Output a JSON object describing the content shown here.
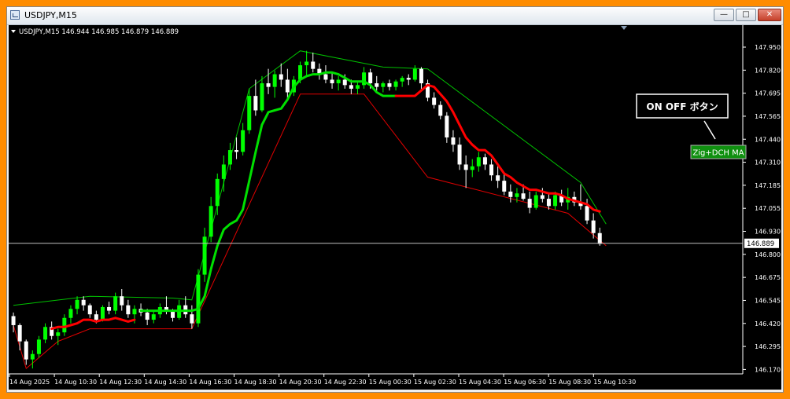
{
  "window": {
    "title": "USDJPY,M15",
    "minimize_label": "—",
    "maximize_label": "□",
    "close_label": "✕"
  },
  "chart_data": {
    "type": "candlestick",
    "symbol_header": "USDJPY,M15  146.944 146.985 146.879 146.889",
    "current_price_label": "146.889",
    "ylim": [
      146.17,
      148.05
    ],
    "yticks": [
      "147.950",
      "147.820",
      "147.695",
      "147.565",
      "147.440",
      "147.310",
      "147.185",
      "147.055",
      "146.930",
      "146.800",
      "146.675",
      "146.545",
      "146.420",
      "146.295",
      "146.170"
    ],
    "xticks": [
      "14 Aug 2025",
      "14 Aug 10:30",
      "14 Aug 12:30",
      "14 Aug 14:30",
      "14 Aug 16:30",
      "14 Aug 18:30",
      "14 Aug 20:30",
      "14 Aug 22:30",
      "15 Aug 00:30",
      "15 Aug 02:30",
      "15 Aug 04:30",
      "15 Aug 06:30",
      "15 Aug 08:30",
      "15 Aug 10:30"
    ],
    "grid": false,
    "colors": {
      "background": "#000000",
      "candle_up": "#00ff00",
      "candle_down": "#ffffff",
      "ma_up": "#00e000",
      "ma_down": "#ff0000",
      "channel_upper": "#00c000",
      "channel_lower": "#e00000",
      "axis_text": "#ffffff",
      "price_line": "#c0c0c0"
    },
    "candles": [
      [
        146.49,
        146.51,
        146.4,
        146.44
      ],
      [
        146.44,
        146.45,
        146.3,
        146.35
      ],
      [
        146.35,
        146.36,
        146.22,
        146.25
      ],
      [
        146.25,
        146.3,
        146.2,
        146.28
      ],
      [
        146.28,
        146.38,
        146.26,
        146.36
      ],
      [
        146.36,
        146.45,
        146.34,
        146.43
      ],
      [
        146.43,
        146.46,
        146.36,
        146.38
      ],
      [
        146.38,
        146.42,
        146.33,
        146.4
      ],
      [
        146.4,
        146.5,
        146.38,
        146.48
      ],
      [
        146.48,
        146.55,
        146.45,
        146.53
      ],
      [
        146.53,
        146.6,
        146.5,
        146.58
      ],
      [
        146.58,
        146.6,
        146.52,
        146.55
      ],
      [
        146.55,
        146.56,
        146.48,
        146.5
      ],
      [
        146.5,
        146.52,
        146.45,
        146.47
      ],
      [
        146.47,
        146.55,
        146.46,
        146.54
      ],
      [
        146.54,
        146.57,
        146.5,
        146.52
      ],
      [
        146.52,
        146.62,
        146.5,
        146.6
      ],
      [
        146.6,
        146.64,
        146.52,
        146.55
      ],
      [
        146.55,
        146.58,
        146.48,
        146.5
      ],
      [
        146.5,
        146.55,
        146.45,
        146.53
      ],
      [
        146.53,
        146.56,
        146.49,
        146.51
      ],
      [
        146.51,
        146.53,
        146.44,
        146.47
      ],
      [
        146.47,
        146.52,
        146.45,
        146.5
      ],
      [
        146.5,
        146.56,
        146.48,
        146.54
      ],
      [
        146.54,
        146.6,
        146.5,
        146.52
      ],
      [
        146.52,
        146.53,
        146.46,
        146.48
      ],
      [
        146.48,
        146.58,
        146.47,
        146.55
      ],
      [
        146.55,
        146.6,
        146.48,
        146.5
      ],
      [
        146.5,
        146.55,
        146.42,
        146.45
      ],
      [
        146.45,
        146.75,
        146.43,
        146.72
      ],
      [
        146.72,
        146.98,
        146.68,
        146.93
      ],
      [
        146.93,
        147.15,
        146.9,
        147.1
      ],
      [
        147.1,
        147.28,
        147.05,
        147.25
      ],
      [
        147.25,
        147.38,
        147.18,
        147.33
      ],
      [
        147.33,
        147.45,
        147.3,
        147.41
      ],
      [
        147.41,
        147.48,
        147.36,
        147.4
      ],
      [
        147.4,
        147.56,
        147.38,
        147.52
      ],
      [
        147.52,
        147.75,
        147.5,
        147.71
      ],
      [
        147.71,
        147.8,
        147.6,
        147.63
      ],
      [
        147.63,
        147.82,
        147.62,
        147.78
      ],
      [
        147.78,
        147.86,
        147.72,
        147.76
      ],
      [
        147.76,
        147.85,
        147.7,
        147.83
      ],
      [
        147.83,
        147.89,
        147.76,
        147.8
      ],
      [
        147.8,
        147.86,
        147.7,
        147.73
      ],
      [
        147.73,
        147.82,
        147.71,
        147.8
      ],
      [
        147.8,
        147.9,
        147.78,
        147.88
      ],
      [
        147.88,
        147.96,
        147.82,
        147.9
      ],
      [
        147.9,
        147.95,
        147.84,
        147.86
      ],
      [
        147.86,
        147.89,
        147.8,
        147.83
      ],
      [
        147.83,
        147.88,
        147.78,
        147.8
      ],
      [
        147.8,
        147.84,
        147.75,
        147.78
      ],
      [
        147.78,
        147.82,
        147.74,
        147.8
      ],
      [
        147.8,
        147.83,
        147.75,
        147.77
      ],
      [
        147.77,
        147.8,
        147.72,
        147.75
      ],
      [
        147.75,
        147.79,
        147.72,
        147.77
      ],
      [
        147.77,
        147.87,
        147.75,
        147.84
      ],
      [
        147.84,
        147.86,
        147.75,
        147.78
      ],
      [
        147.78,
        147.82,
        147.74,
        147.76
      ],
      [
        147.76,
        147.79,
        147.73,
        147.78
      ],
      [
        147.78,
        147.8,
        147.74,
        147.76
      ],
      [
        147.76,
        147.8,
        147.74,
        147.79
      ],
      [
        147.79,
        147.82,
        147.76,
        147.81
      ],
      [
        147.81,
        147.83,
        147.77,
        147.8
      ],
      [
        147.8,
        147.88,
        147.79,
        147.86
      ],
      [
        147.86,
        147.87,
        147.75,
        147.78
      ],
      [
        147.78,
        147.8,
        147.68,
        147.7
      ],
      [
        147.7,
        147.73,
        147.64,
        147.66
      ],
      [
        147.66,
        147.68,
        147.58,
        147.6
      ],
      [
        147.6,
        147.62,
        147.45,
        147.48
      ],
      [
        147.48,
        147.52,
        147.4,
        147.44
      ],
      [
        147.44,
        147.48,
        147.3,
        147.33
      ],
      [
        147.33,
        147.38,
        147.2,
        147.3
      ],
      [
        147.3,
        147.36,
        147.26,
        147.32
      ],
      [
        147.32,
        147.4,
        147.29,
        147.37
      ],
      [
        147.37,
        147.39,
        147.3,
        147.33
      ],
      [
        147.33,
        147.36,
        147.24,
        147.27
      ],
      [
        147.27,
        147.32,
        147.2,
        147.24
      ],
      [
        147.24,
        147.28,
        147.16,
        147.18
      ],
      [
        147.18,
        147.22,
        147.12,
        147.15
      ],
      [
        147.15,
        147.2,
        147.12,
        147.17
      ],
      [
        147.17,
        147.22,
        147.13,
        147.14
      ],
      [
        147.14,
        147.18,
        147.06,
        147.09
      ],
      [
        147.09,
        147.18,
        147.08,
        147.16
      ],
      [
        147.16,
        147.2,
        147.12,
        147.14
      ],
      [
        147.14,
        147.17,
        147.08,
        147.1
      ],
      [
        147.1,
        147.18,
        147.08,
        147.16
      ],
      [
        147.16,
        147.19,
        147.1,
        147.12
      ],
      [
        147.12,
        147.2,
        147.08,
        147.15
      ],
      [
        147.15,
        147.18,
        147.1,
        147.12
      ],
      [
        147.12,
        147.22,
        147.08,
        147.1
      ],
      [
        147.1,
        147.14,
        147.0,
        147.02
      ],
      [
        147.02,
        147.06,
        146.92,
        146.95
      ],
      [
        146.95,
        146.98,
        146.88,
        146.89
      ]
    ],
    "ma_series": [
      {
        "color": "red",
        "points": [
          [
            6,
            146.42
          ],
          [
            7,
            146.43
          ],
          [
            8,
            146.43
          ],
          [
            9,
            146.44
          ],
          [
            10,
            146.45
          ],
          [
            11,
            146.47
          ],
          [
            12,
            146.47
          ],
          [
            13,
            146.46
          ],
          [
            14,
            146.47
          ],
          [
            15,
            146.47
          ],
          [
            16,
            146.48
          ],
          [
            17,
            146.47
          ],
          [
            18,
            146.46
          ],
          [
            19,
            146.47
          ]
        ]
      },
      {
        "color": "green",
        "points": [
          [
            20,
            146.52
          ],
          [
            21,
            146.52
          ],
          [
            22,
            146.52
          ],
          [
            23,
            146.52
          ],
          [
            24,
            146.52
          ],
          [
            25,
            146.52
          ],
          [
            26,
            146.52
          ],
          [
            27,
            146.52
          ],
          [
            28,
            146.52
          ],
          [
            29,
            146.53
          ],
          [
            30,
            146.6
          ],
          [
            31,
            146.75
          ],
          [
            32,
            146.88
          ],
          [
            33,
            146.97
          ],
          [
            34,
            147.0
          ],
          [
            35,
            147.02
          ],
          [
            36,
            147.08
          ],
          [
            37,
            147.24
          ],
          [
            38,
            147.4
          ],
          [
            39,
            147.55
          ],
          [
            40,
            147.62
          ],
          [
            41,
            147.63
          ],
          [
            42,
            147.64
          ],
          [
            43,
            147.69
          ],
          [
            44,
            147.76
          ],
          [
            45,
            147.8
          ],
          [
            46,
            147.82
          ],
          [
            47,
            147.83
          ],
          [
            48,
            147.83
          ],
          [
            49,
            147.84
          ],
          [
            50,
            147.84
          ],
          [
            51,
            147.83
          ],
          [
            52,
            147.81
          ],
          [
            53,
            147.79
          ],
          [
            54,
            147.79
          ],
          [
            55,
            147.79
          ],
          [
            56,
            147.77
          ],
          [
            57,
            147.73
          ],
          [
            58,
            147.71
          ],
          [
            59,
            147.71
          ],
          [
            60,
            147.71
          ]
        ]
      },
      {
        "color": "red",
        "points": [
          [
            60,
            147.71
          ],
          [
            61,
            147.71
          ],
          [
            62,
            147.71
          ],
          [
            63,
            147.71
          ],
          [
            64,
            147.74
          ],
          [
            65,
            147.77
          ],
          [
            66,
            147.76
          ],
          [
            67,
            147.72
          ],
          [
            68,
            147.68
          ],
          [
            69,
            147.62
          ],
          [
            70,
            147.55
          ],
          [
            71,
            147.48
          ],
          [
            72,
            147.44
          ],
          [
            73,
            147.41
          ],
          [
            74,
            147.41
          ],
          [
            75,
            147.38
          ],
          [
            76,
            147.33
          ],
          [
            77,
            147.28
          ],
          [
            78,
            147.26
          ],
          [
            79,
            147.23
          ],
          [
            80,
            147.21
          ],
          [
            81,
            147.19
          ],
          [
            82,
            147.19
          ],
          [
            83,
            147.18
          ],
          [
            84,
            147.17
          ],
          [
            85,
            147.17
          ],
          [
            86,
            147.16
          ],
          [
            87,
            147.14
          ],
          [
            88,
            147.13
          ],
          [
            89,
            147.12
          ],
          [
            90,
            147.11
          ],
          [
            91,
            147.08
          ],
          [
            92,
            147.07
          ]
        ]
      }
    ],
    "channel_upper": [
      [
        0,
        146.55
      ],
      [
        12,
        146.6
      ],
      [
        25,
        146.59
      ],
      [
        28,
        146.58
      ],
      [
        37,
        147.75
      ],
      [
        45,
        147.96
      ],
      [
        58,
        147.87
      ],
      [
        65,
        147.86
      ],
      [
        89,
        147.23
      ],
      [
        93,
        147.0
      ]
    ],
    "channel_lower": [
      [
        0,
        146.44
      ],
      [
        2,
        146.2
      ],
      [
        7,
        146.35
      ],
      [
        12,
        146.42
      ],
      [
        20,
        146.42
      ],
      [
        28,
        146.42
      ],
      [
        45,
        147.72
      ],
      [
        55,
        147.72
      ],
      [
        65,
        147.26
      ],
      [
        87,
        147.06
      ],
      [
        93,
        146.88
      ]
    ],
    "annotation": {
      "label": "ON OFF  ボタン"
    },
    "toggle_button": {
      "label": "Zig+DCH MA"
    }
  }
}
